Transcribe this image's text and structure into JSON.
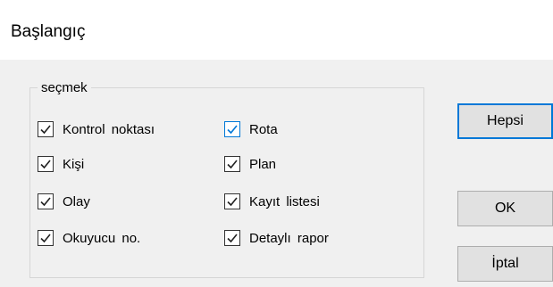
{
  "window": {
    "title": "Başlangıç"
  },
  "group": {
    "label": "seçmek",
    "checkboxes": [
      {
        "label": "Kontrol  noktası",
        "checked": true
      },
      {
        "label": "Kişi",
        "checked": true
      },
      {
        "label": "Olay",
        "checked": true
      },
      {
        "label": "Okuyucu  no.",
        "checked": true
      },
      {
        "label": "Rota",
        "checked": true,
        "focused": true
      },
      {
        "label": "Plan",
        "checked": true
      },
      {
        "label": "Kayıt  listesi",
        "checked": true
      },
      {
        "label": "Detaylı  rapor",
        "checked": true
      }
    ]
  },
  "buttons": {
    "all": "Hepsi",
    "ok": "OK",
    "cancel": "İptal"
  },
  "colors": {
    "focus": "#0078d7",
    "face": "#e1e1e1",
    "background": "#f0f0f0"
  }
}
